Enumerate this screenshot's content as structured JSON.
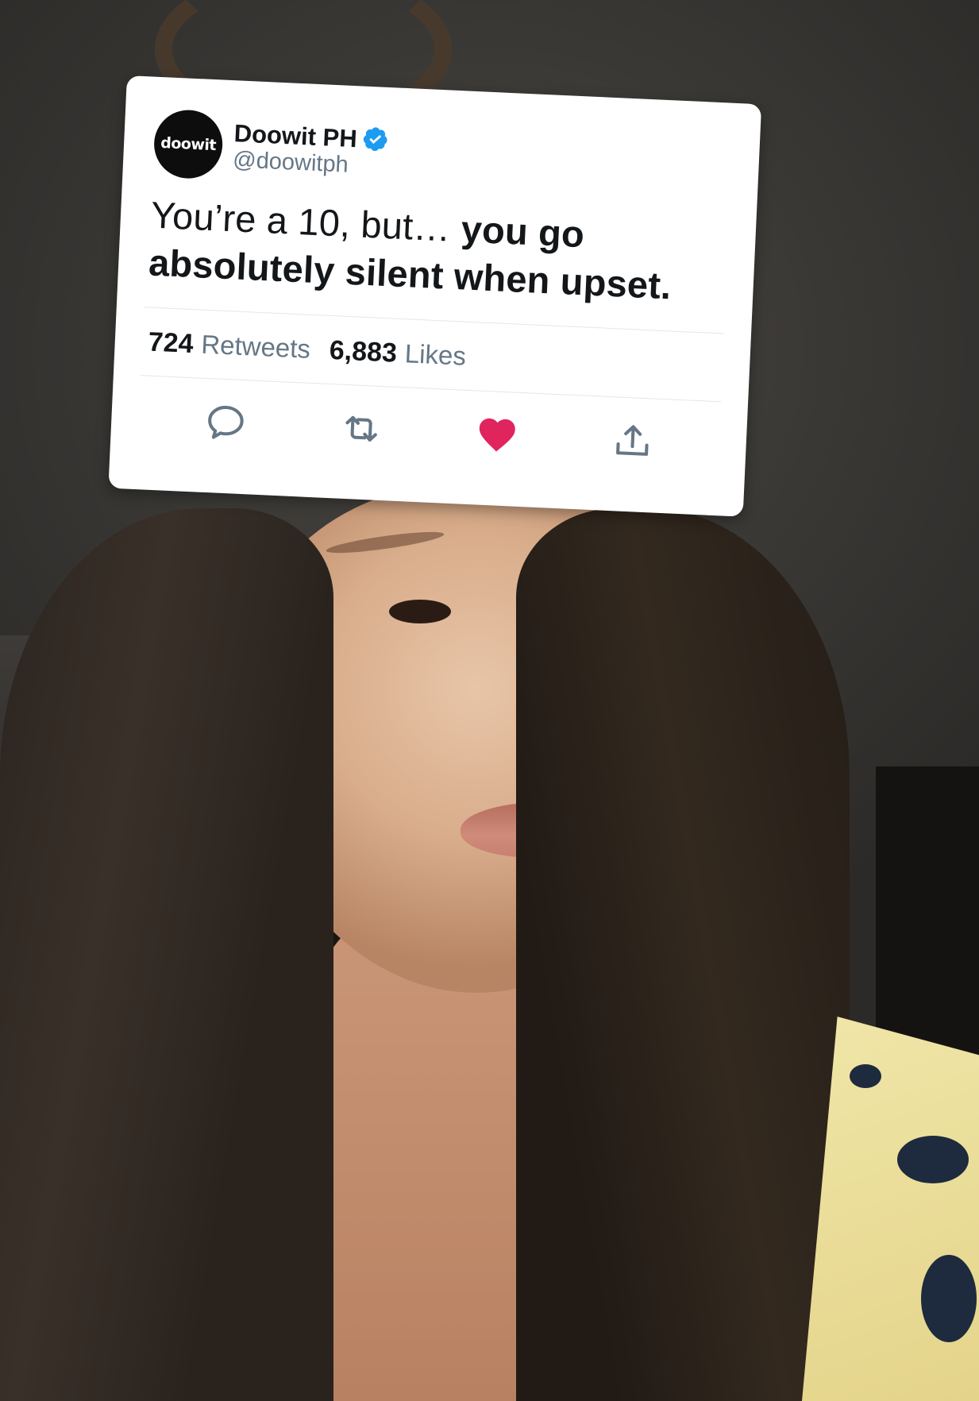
{
  "tweet": {
    "avatar_text": "doowit",
    "display_name": "Doowit PH",
    "handle": "@doowitph",
    "text_regular": "You’re a 10, but… ",
    "text_bold": "you go absolutely silent when upset.",
    "retweets_count": "724",
    "retweets_label": "Retweets",
    "likes_count": "6,883",
    "likes_label": "Likes",
    "liked": true
  },
  "icons": {
    "verified": "verified-badge-icon",
    "reply": "reply-icon",
    "retweet": "retweet-icon",
    "like": "heart-icon",
    "share": "share-icon"
  },
  "colors": {
    "verified_blue": "#1d9bf0",
    "like_red": "#e0245e",
    "icon_gray": "#657786"
  }
}
